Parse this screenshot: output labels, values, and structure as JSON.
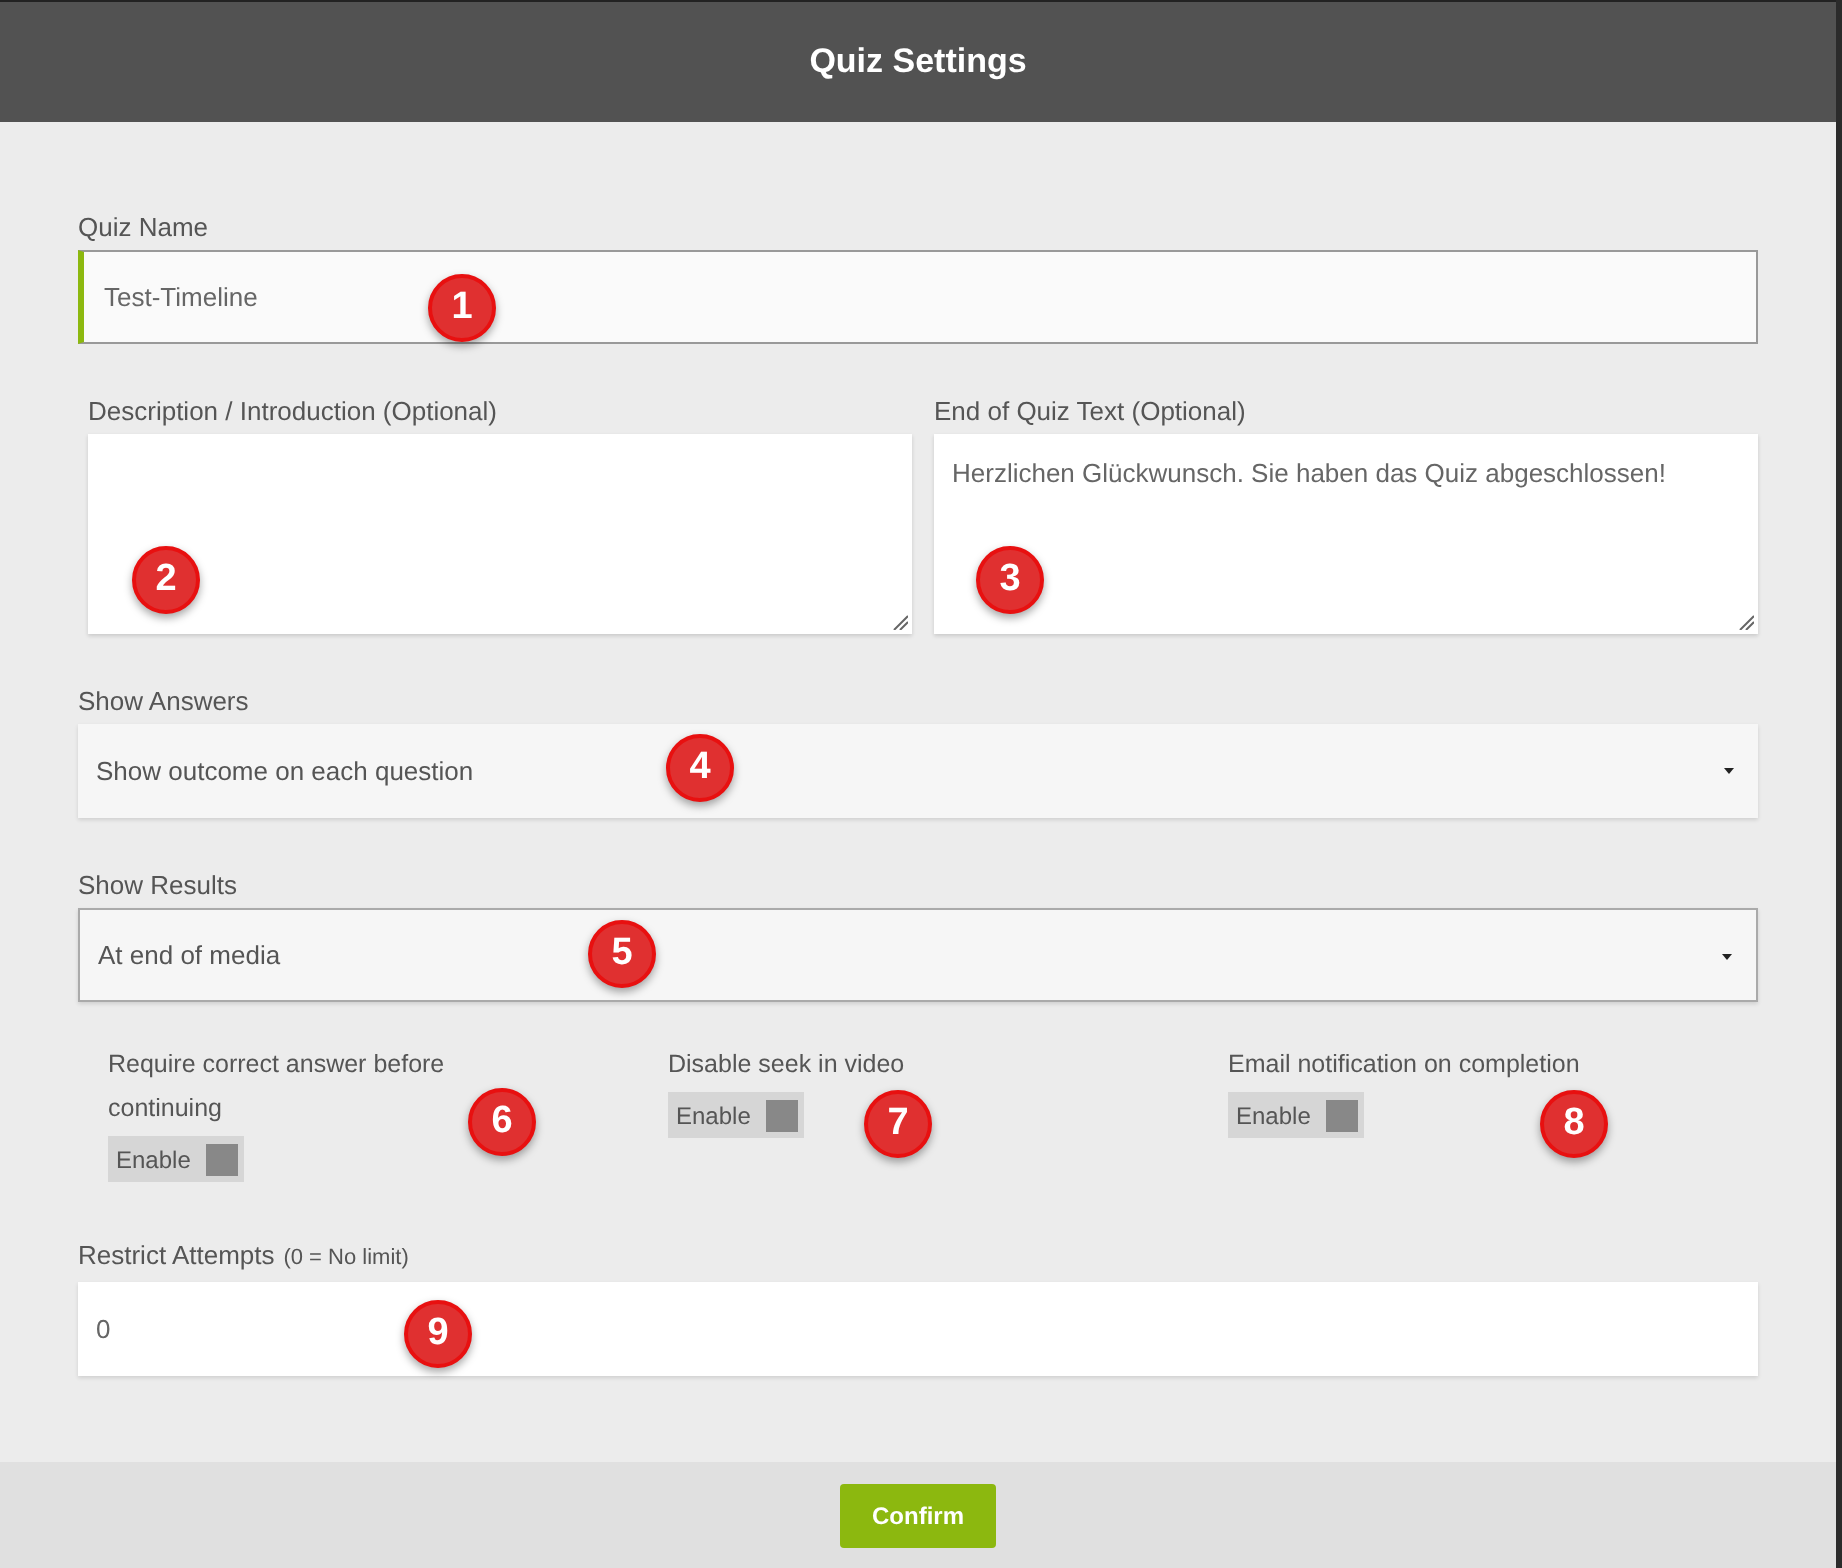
{
  "window": {
    "title": "Quiz Settings"
  },
  "quiz_name": {
    "label": "Quiz Name",
    "value": "Test-Timeline",
    "focused": true,
    "marker": "1"
  },
  "description": {
    "label": "Description / Introduction (Optional)",
    "marker": "2"
  },
  "end_text": {
    "label": "End of Quiz Text (Optional)",
    "value": "Herzlichen Glückwunsch. Sie haben das Quiz abgeschlossen!",
    "marker": "3"
  },
  "show_answers": {
    "label": "Show Answers",
    "value": "Show outcome on each question",
    "focused": false,
    "marker": "4"
  },
  "show_results": {
    "label": "Show Results",
    "value": "At end of media",
    "focused": true,
    "marker": "5"
  },
  "toggles": [
    {
      "label": "Require correct answer before continuing",
      "switch_label": "Enable",
      "on": false,
      "marker": "6"
    },
    {
      "label": "Disable seek in video",
      "switch_label": "Enable",
      "on": false,
      "marker": "7"
    },
    {
      "label": "Email notification on completion",
      "switch_label": "Enable",
      "on": false,
      "marker": "8"
    }
  ],
  "restrict_attempts": {
    "label": "Restrict Attempts",
    "hint": "(0 = No limit)",
    "value": "0",
    "marker": "9"
  },
  "buttons": [
    "Confirm"
  ]
}
